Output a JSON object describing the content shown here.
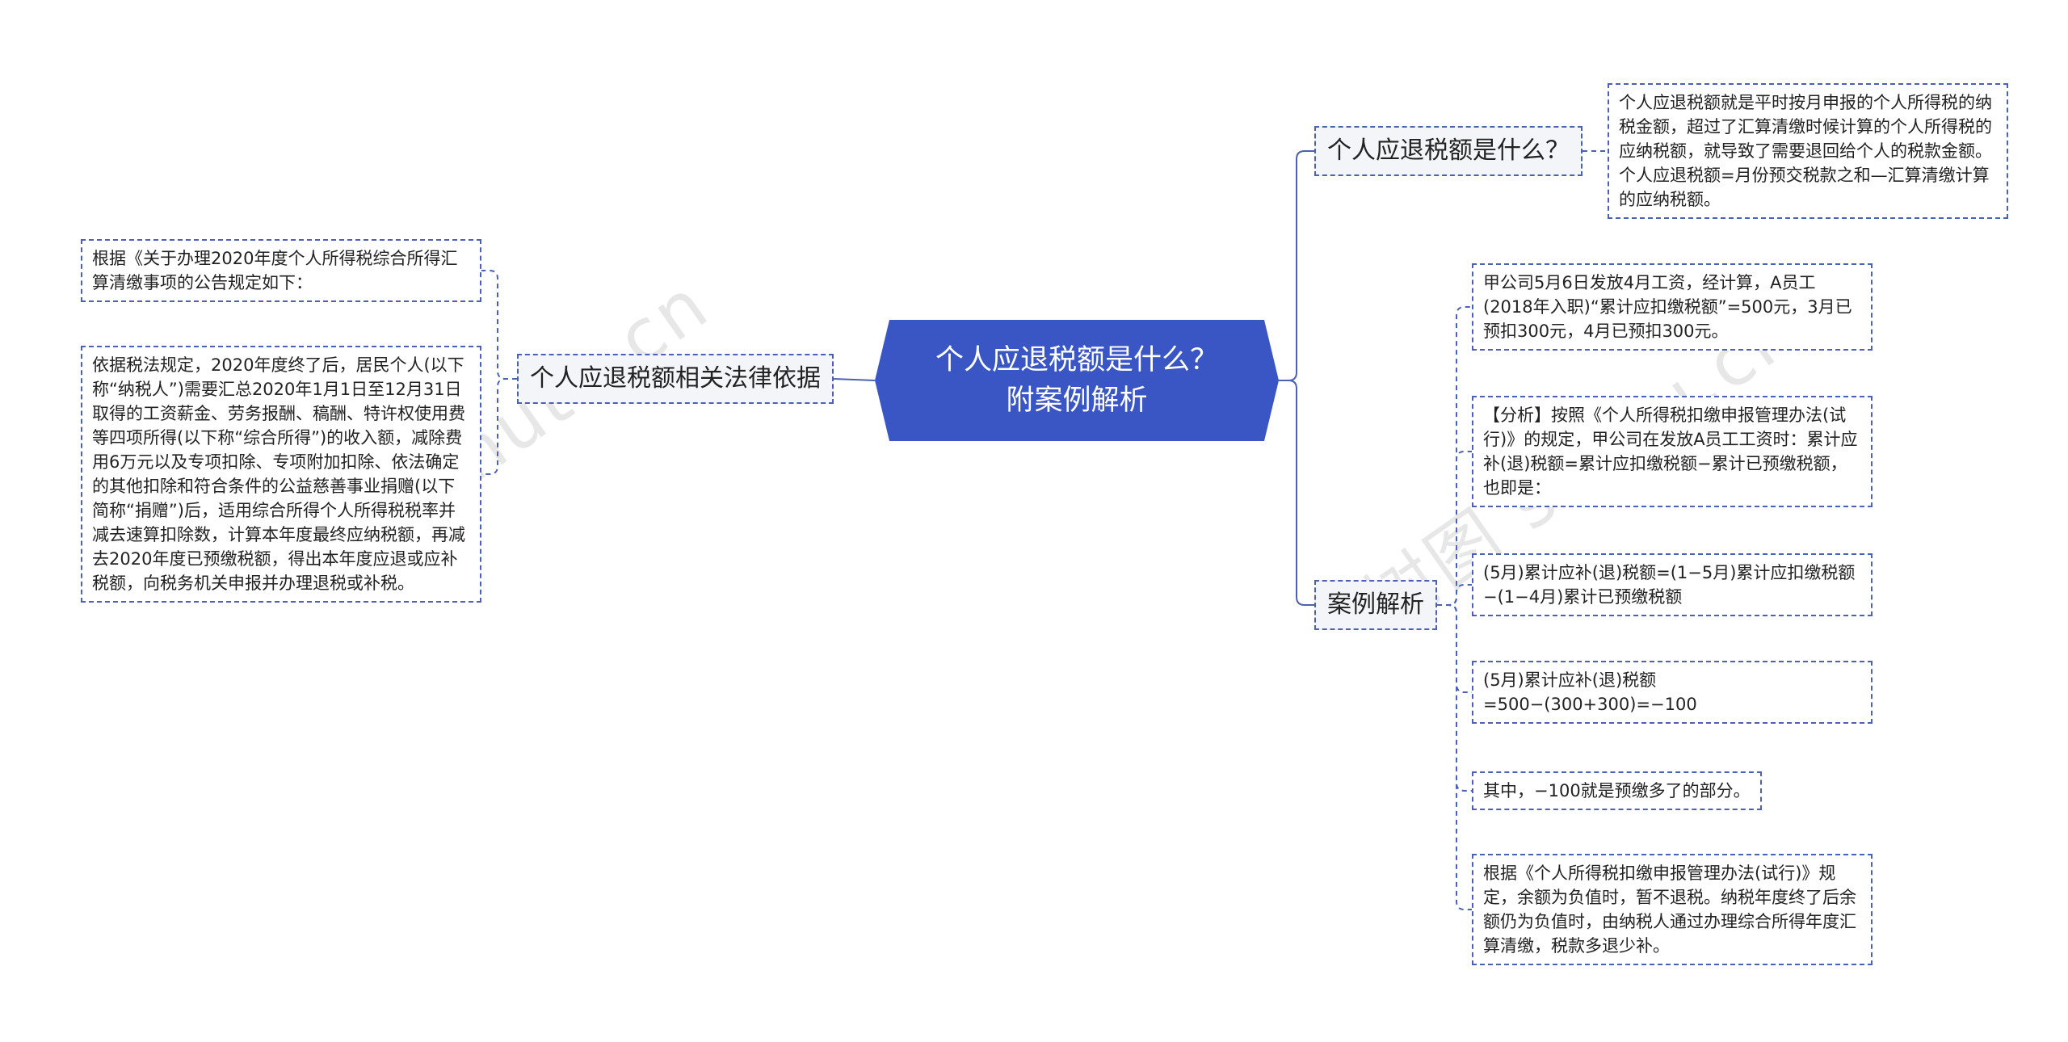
{
  "root": {
    "title": "个人应退税额是什么？附案例解析"
  },
  "branches": {
    "law": {
      "label": "个人应退税额相关法律依据",
      "leaves": [
        "根据《关于办理2020年度个人所得税综合所得汇算清缴事项的公告规定如下：",
        "依据税法规定，2020年度终了后，居民个人(以下称“纳税人”)需要汇总2020年1月1日至12月31日取得的工资薪金、劳务报酬、稿酬、特许权使用费等四项所得(以下称“综合所得”)的收入额，减除费用6万元以及专项扣除、专项附加扣除、依法确定的其他扣除和符合条件的公益慈善事业捐赠(以下简称“捐赠”)后，适用综合所得个人所得税税率并减去速算扣除数，计算本年度最终应纳税额，再减去2020年度已预缴税额，得出本年度应退或应补税额，向税务机关申报并办理退税或补税。"
      ]
    },
    "what": {
      "label": "个人应退税额是什么？",
      "leaves": [
        "个人应退税额就是平时按月申报的个人所得税的纳税金额，超过了汇算清缴时候计算的个人所得税的应纳税额，就导致了需要退回给个人的税款金额。个人应退税额=月份预交税款之和—汇算清缴计算的应纳税额。"
      ]
    },
    "case": {
      "label": "案例解析",
      "leaves": [
        "甲公司5月6日发放4月工资，经计算，A员工(2018年入职)“累计应扣缴税额”=500元，3月已预扣300元，4月已预扣300元。",
        "【分析】按照《个人所得税扣缴申报管理办法(试行)》的规定，甲公司在发放A员工工资时：累计应补(退)税额=累计应扣缴税额−累计已预缴税额，也即是：",
        "(5月)累计应补(退)税额=(1−5月)累计应扣缴税额−(1−4月)累计已预缴税额",
        "(5月)累计应补(退)税额=500−(300+300)=−100",
        "其中，−100就是预缴多了的部分。",
        "根据《个人所得税扣缴申报管理办法(试行)》规定，余额为负值时，暂不退税。纳税年度终了后余额仍为负值时，由纳税人通过办理综合所得年度汇算清缴，税款多退少补。"
      ]
    }
  },
  "watermarks": [
    "shutu.cn",
    "树图 shutu.cn"
  ],
  "colors": {
    "root_fill": "#3a56c5",
    "line": "#4a62b0",
    "topic_fill": "#f3f5f9"
  }
}
